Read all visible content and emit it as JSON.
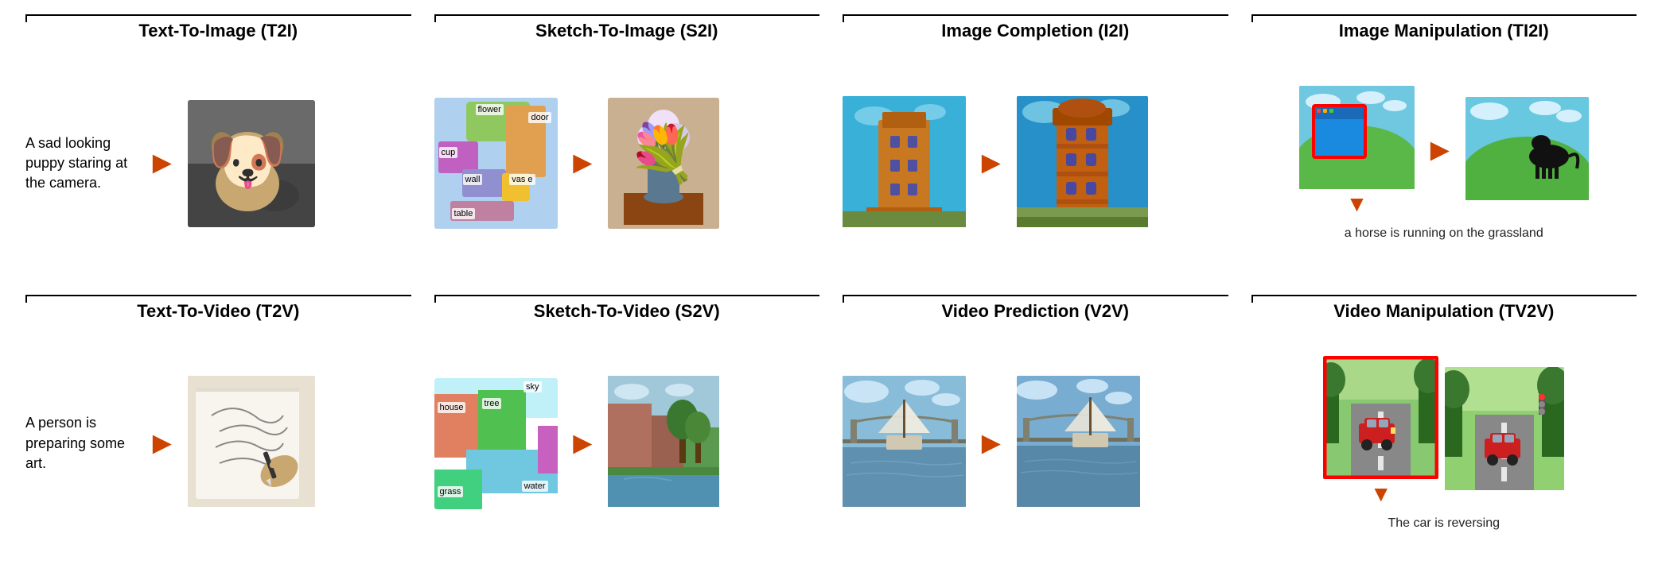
{
  "sections": {
    "t2i": {
      "title": "Text-To-Image (T2I)",
      "text": "A sad looking puppy staring at the camera.",
      "images": [
        "puppy_with_sunglasses"
      ]
    },
    "s2i": {
      "title": "Sketch-To-Image (S2I)",
      "seg_labels": {
        "flower": "flower",
        "door": "door",
        "cup": "cup",
        "wall": "wall",
        "vase": "vas e",
        "table": "table"
      },
      "images": [
        "flower_vase_result"
      ]
    },
    "i2i": {
      "title": "Image Completion (I2I)",
      "images": [
        "tower_before",
        "tower_after"
      ]
    },
    "ti2i": {
      "title": "Image Manipulation (TI2I)",
      "caption": "a horse is running on the grassland",
      "images": [
        "grassland_screen_before",
        "horse_grassland_after"
      ]
    },
    "t2v": {
      "title": "Text-To-Video (T2V)",
      "text": "A person is preparing some art.",
      "images": [
        "art_drawing"
      ]
    },
    "s2v": {
      "title": "Sketch-To-Video (S2V)",
      "seg_labels": {
        "house": "house",
        "sky": "sky",
        "tree": "tree",
        "grass": "grass",
        "water": "water"
      },
      "images": [
        "landscape_video"
      ]
    },
    "v2v": {
      "title": "Video Prediction (V2V)",
      "images": [
        "sailboat_before",
        "sailboat_after"
      ]
    },
    "tv2v": {
      "title": "Video Manipulation (TV2V)",
      "caption": "The car is reversing",
      "images": [
        "road_car_before",
        "road_car_after"
      ]
    }
  },
  "arrow": "➤",
  "colors": {
    "arrow": "#cc4400",
    "red_border": "#ff0000",
    "title_color": "#111111"
  }
}
